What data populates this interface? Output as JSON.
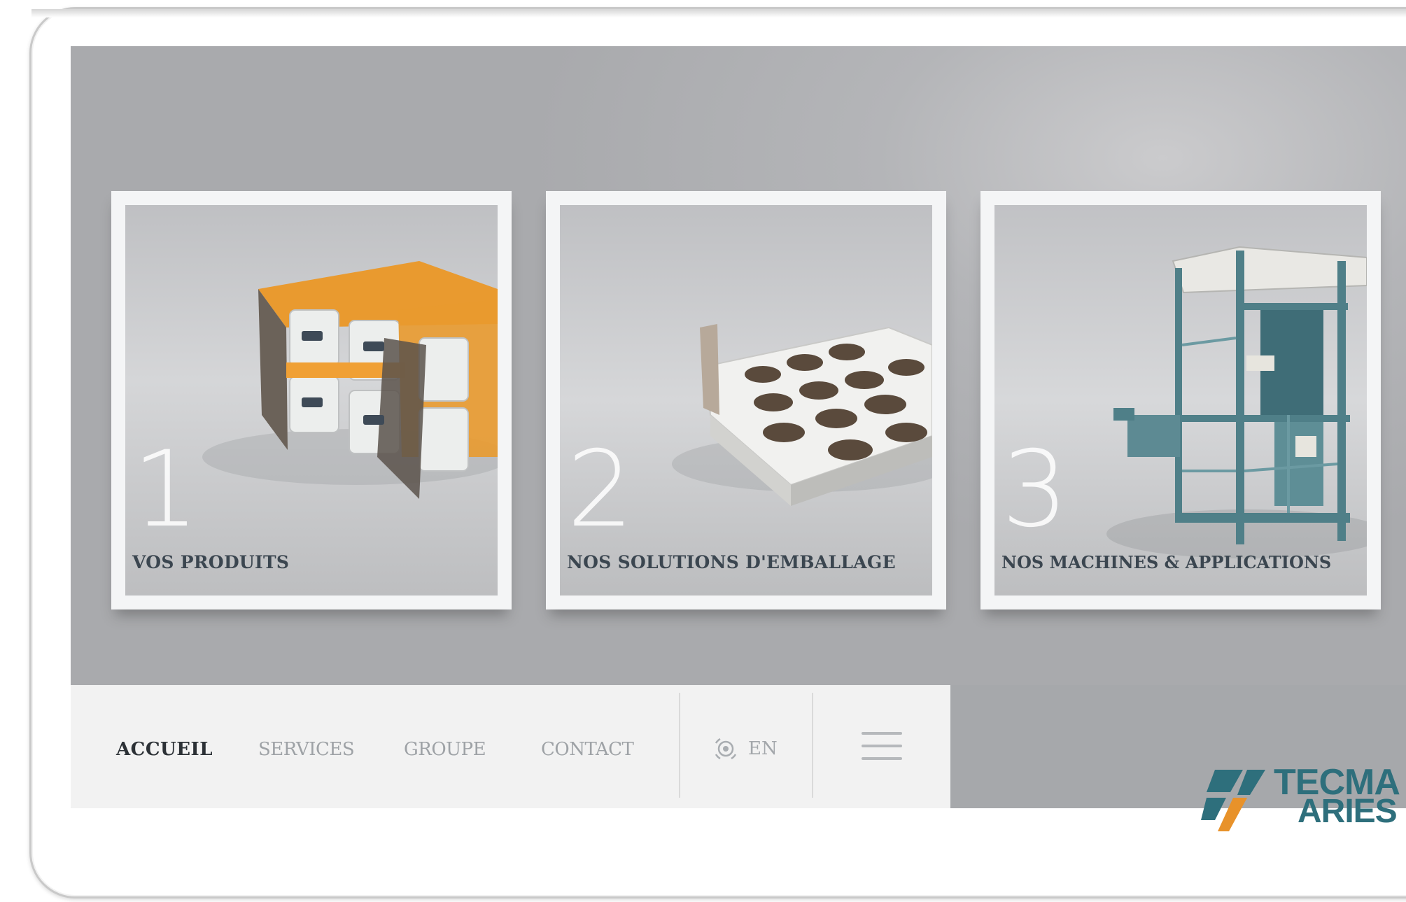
{
  "hero": {
    "cards": [
      {
        "number": "1",
        "label": "VOS PRODUITS"
      },
      {
        "number": "2",
        "label": "NOS SOLUTIONS D'EMBALLAGE"
      },
      {
        "number": "3",
        "label": "NOS MACHINES & APPLICATIONS"
      }
    ]
  },
  "nav": {
    "items": [
      {
        "label": "ACCUEIL",
        "active": true
      },
      {
        "label": "SERVICES",
        "active": false
      },
      {
        "label": "GROUPE",
        "active": false
      },
      {
        "label": "CONTACT",
        "active": false
      }
    ],
    "language": {
      "icon": "globe-icon",
      "label": "EN"
    },
    "menu_icon": "hamburger-menu-icon"
  },
  "brand": {
    "line1": "TECMA",
    "line2": "ARIES",
    "colors": {
      "teal": "#2e6f7c",
      "orange": "#e8922a"
    }
  },
  "colors": {
    "hero_background": "#adaeb1",
    "nav_background": "#f2f2f2",
    "brand_bar": "#a6a8ab",
    "active_nav_text": "#2c3136",
    "inactive_nav_text": "#9ea2a6",
    "card_label": "#3b4650"
  }
}
